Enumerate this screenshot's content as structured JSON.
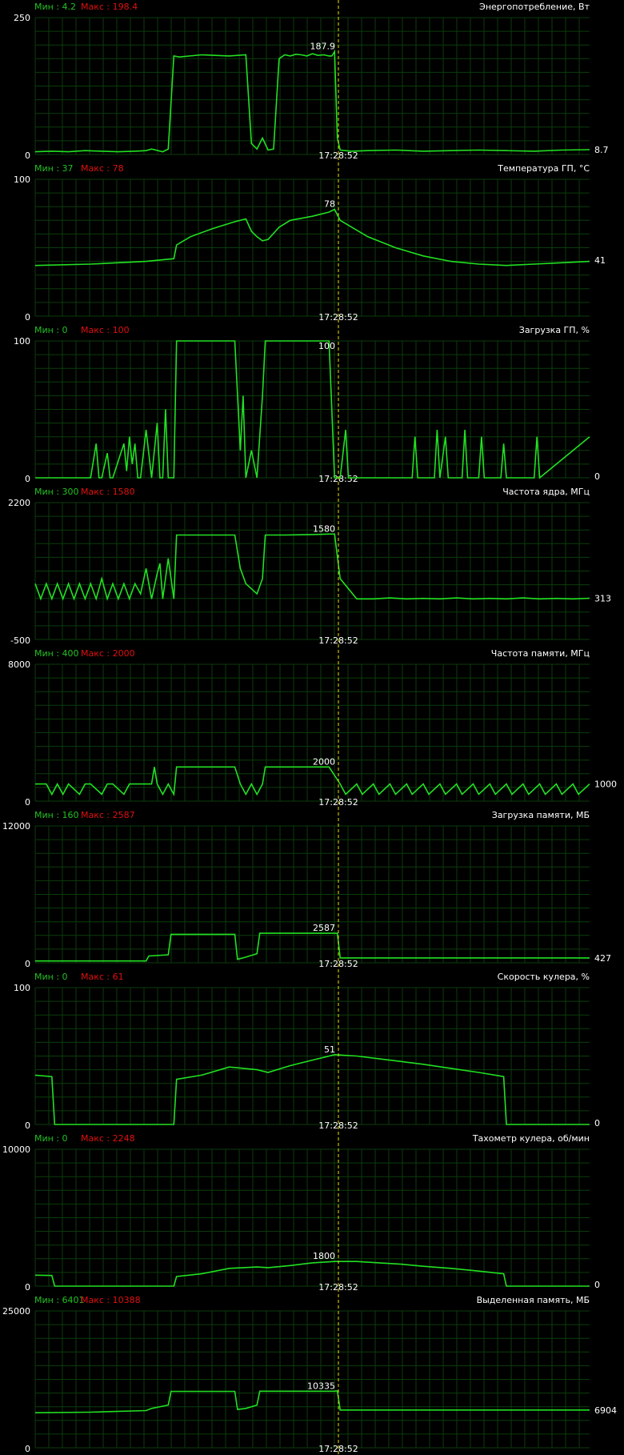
{
  "colors": {
    "background": "#000000",
    "grid": "#0b3d0b",
    "trace": "#22e022",
    "min_label": "#22c022",
    "max_label": "#e01010",
    "cursor": "#f0e000",
    "text": "#ffffff"
  },
  "cursor_time": "17:28:52",
  "chart_data": [
    {
      "type": "line",
      "title": "Энергопотребление, Вт",
      "min_label": "Мин : 4.2",
      "max_label": "Макс : 198.4",
      "ylim": [
        0,
        250
      ],
      "y_top_label": "250",
      "y_bottom_label": "0",
      "cursor_value": "187.9",
      "current_value": "8.7",
      "x": [
        0,
        3,
        6,
        9,
        12,
        15,
        18,
        20,
        21,
        23,
        24,
        25,
        26,
        30,
        35,
        38,
        39,
        40,
        41,
        42,
        43,
        44,
        45,
        46,
        47,
        48,
        49,
        50,
        51,
        52,
        53,
        53.5,
        54,
        54.5,
        55,
        57,
        60,
        65,
        70,
        75,
        80,
        85,
        90,
        95,
        100
      ],
      "y": [
        5,
        6,
        5,
        7,
        6,
        5,
        6,
        7,
        10,
        5,
        10,
        180,
        178,
        182,
        180,
        182,
        20,
        10,
        30,
        8,
        10,
        175,
        182,
        180,
        183,
        182,
        180,
        184,
        181,
        182,
        180,
        180,
        187.9,
        30,
        8,
        6,
        7,
        8,
        6,
        7,
        8,
        7,
        6,
        8,
        8.7
      ]
    },
    {
      "type": "line",
      "title": "Температура ГП, °C",
      "min_label": "Мин : 37",
      "max_label": "Макс : 78",
      "ylim": [
        0,
        100
      ],
      "y_top_label": "100",
      "y_bottom_label": "0",
      "cursor_value": "78",
      "current_value": "41",
      "x": [
        0,
        10,
        20,
        25,
        25.5,
        28,
        32,
        36,
        38,
        39,
        40,
        41,
        42,
        44,
        46,
        50,
        53,
        54,
        55,
        60,
        65,
        70,
        75,
        80,
        85,
        90,
        95,
        100
      ],
      "y": [
        37,
        38,
        40,
        42,
        52,
        58,
        64,
        69,
        71,
        62,
        58,
        55,
        56,
        65,
        70,
        73,
        76,
        78,
        70,
        58,
        50,
        44,
        40,
        38,
        37,
        38,
        39,
        40
      ]
    },
    {
      "type": "line",
      "title": "Загрузка ГП, %",
      "min_label": "Мин : 0",
      "max_label": "Макс : 100",
      "ylim": [
        0,
        100
      ],
      "y_top_label": "100",
      "y_bottom_label": "0",
      "cursor_value": "100",
      "current_value": "0",
      "x": [
        0,
        10,
        11,
        11.5,
        12,
        13,
        13.5,
        14,
        16,
        16.5,
        17,
        17.5,
        18,
        18.5,
        19,
        20,
        21,
        22,
        22.5,
        23,
        23.5,
        24,
        24.5,
        25,
        25.5,
        27,
        32,
        36,
        37,
        37.5,
        38,
        39,
        40,
        41,
        41.5,
        42,
        48,
        53,
        54,
        55,
        56,
        56.5,
        57,
        58,
        68,
        68.5,
        69,
        72,
        72.5,
        73,
        74,
        74.5,
        75,
        77,
        77.5,
        78,
        80,
        80.5,
        81,
        84,
        84.5,
        85,
        90,
        90.5,
        91,
        100
      ],
      "y": [
        0,
        0,
        25,
        0,
        0,
        18,
        0,
        0,
        25,
        5,
        30,
        10,
        25,
        0,
        0,
        35,
        0,
        40,
        0,
        0,
        50,
        0,
        0,
        0,
        100,
        100,
        100,
        100,
        20,
        60,
        0,
        20,
        0,
        60,
        100,
        100,
        100,
        100,
        0,
        0,
        35,
        0,
        0,
        0,
        0,
        30,
        0,
        0,
        35,
        0,
        30,
        0,
        0,
        0,
        35,
        0,
        0,
        30,
        0,
        0,
        25,
        0,
        0,
        30,
        0,
        30
      ]
    },
    {
      "type": "line",
      "title": "Частота ядра, МГц",
      "min_label": "Мин : 300",
      "max_label": "Макс : 1580",
      "ylim": [
        -500,
        2200
      ],
      "y_top_label": "2200",
      "y_bottom_label": "-500",
      "cursor_value": "1580",
      "current_value": "313",
      "x": [
        0,
        1,
        2,
        3,
        4,
        5,
        6,
        7,
        8,
        9,
        10,
        11,
        12,
        13,
        14,
        15,
        16,
        17,
        18,
        19,
        20,
        21,
        22,
        22.5,
        23,
        24,
        25,
        25.5,
        30,
        36,
        37,
        38,
        39,
        40,
        41,
        41.5,
        45,
        50,
        53,
        54,
        55,
        58,
        61,
        64,
        67,
        70,
        73,
        76,
        79,
        82,
        85,
        88,
        91,
        94,
        97,
        100
      ],
      "y": [
        600,
        300,
        600,
        300,
        600,
        300,
        600,
        300,
        600,
        300,
        600,
        300,
        700,
        300,
        600,
        300,
        600,
        300,
        600,
        400,
        900,
        300,
        800,
        1000,
        300,
        1100,
        300,
        1560,
        1560,
        1560,
        900,
        600,
        500,
        400,
        700,
        1560,
        1560,
        1570,
        1580,
        1580,
        700,
        300,
        300,
        320,
        300,
        310,
        300,
        320,
        300,
        310,
        300,
        320,
        300,
        310,
        300,
        313
      ]
    },
    {
      "type": "line",
      "title": "Частота памяти, МГц",
      "min_label": "Мин : 400",
      "max_label": "Макс : 2000",
      "ylim": [
        0,
        8000
      ],
      "y_top_label": "8000",
      "y_bottom_label": "0",
      "cursor_value": "2000",
      "current_value": "1000",
      "x": [
        0,
        2,
        3,
        4,
        5,
        6,
        8,
        9,
        10,
        12,
        13,
        14,
        16,
        17,
        18,
        21,
        21.5,
        22,
        23,
        24,
        25,
        25.5,
        36,
        37,
        38,
        39,
        40,
        41,
        41.5,
        53,
        55,
        56,
        58,
        59,
        61,
        62,
        64,
        65,
        67,
        68,
        70,
        71,
        73,
        74,
        76,
        77,
        79,
        80,
        82,
        83,
        85,
        86,
        88,
        89,
        91,
        92,
        94,
        95,
        97,
        98,
        100
      ],
      "y": [
        1000,
        1000,
        400,
        1000,
        400,
        1000,
        400,
        1000,
        1000,
        400,
        1000,
        1000,
        400,
        1000,
        1000,
        1000,
        2000,
        1000,
        400,
        1000,
        400,
        2000,
        2000,
        1000,
        400,
        1000,
        400,
        1000,
        2000,
        2000,
        1000,
        400,
        1000,
        400,
        1000,
        400,
        1000,
        400,
        1000,
        400,
        1000,
        400,
        1000,
        400,
        1000,
        400,
        1000,
        400,
        1000,
        400,
        1000,
        400,
        1000,
        400,
        1000,
        400,
        1000,
        400,
        1000,
        400,
        1000
      ]
    },
    {
      "type": "line",
      "title": "Загрузка памяти, МБ",
      "min_label": "Мин : 160",
      "max_label": "Макс : 2587",
      "ylim": [
        0,
        12000
      ],
      "y_top_label": "12000",
      "y_bottom_label": "0",
      "cursor_value": "2587",
      "current_value": "427",
      "x": [
        0,
        10,
        20,
        20.5,
        24,
        24.5,
        36,
        36.5,
        38,
        40,
        40.5,
        53,
        54,
        54.5,
        55,
        60,
        70,
        80,
        90,
        100
      ],
      "y": [
        160,
        160,
        160,
        600,
        700,
        2500,
        2500,
        300,
        500,
        800,
        2587,
        2587,
        2587,
        2587,
        427,
        427,
        427,
        427,
        427,
        427
      ]
    },
    {
      "type": "line",
      "title": "Скорость кулера, %",
      "min_label": "Мин : 0",
      "max_label": "Макс : 61",
      "ylim": [
        0,
        100
      ],
      "y_top_label": "100",
      "y_bottom_label": "0",
      "cursor_value": "51",
      "current_value": "0",
      "x": [
        0,
        3,
        3.5,
        25,
        25.5,
        30,
        35,
        40,
        42,
        46,
        50,
        54,
        58,
        62,
        66,
        70,
        75,
        80,
        84.5,
        85,
        100
      ],
      "y": [
        36,
        35,
        0,
        0,
        33,
        36,
        42,
        40,
        38,
        43,
        47,
        51,
        50,
        48,
        46,
        44,
        41,
        38,
        35,
        0,
        0
      ]
    },
    {
      "type": "line",
      "title": "Тахометр кулера, об/мин",
      "min_label": "Мин : 0",
      "max_label": "Макс : 2248",
      "ylim": [
        0,
        10000
      ],
      "y_top_label": "10000",
      "y_bottom_label": "0",
      "cursor_value": "1800",
      "current_value": "0",
      "x": [
        0,
        3,
        3.5,
        25,
        25.5,
        30,
        35,
        40,
        42,
        46,
        50,
        54,
        58,
        62,
        66,
        70,
        75,
        80,
        84.5,
        85,
        100
      ],
      "y": [
        800,
        780,
        0,
        0,
        700,
        900,
        1300,
        1400,
        1350,
        1500,
        1700,
        1800,
        1800,
        1700,
        1600,
        1450,
        1300,
        1100,
        900,
        0,
        0
      ]
    },
    {
      "type": "line",
      "title": "Выделенная память, МБ",
      "min_label": "Мин : 6401",
      "max_label": "Макс : 10388",
      "ylim": [
        0,
        25000
      ],
      "y_top_label": "25000",
      "y_bottom_label": "0",
      "cursor_value": "10335",
      "current_value": "6904",
      "x": [
        0,
        10,
        20,
        21,
        24,
        24.5,
        36,
        36.5,
        38,
        40,
        40.5,
        53,
        54,
        54.5,
        55,
        60,
        70,
        80,
        90,
        100
      ],
      "y": [
        6401,
        6500,
        6800,
        7200,
        7800,
        10300,
        10300,
        7000,
        7200,
        7800,
        10335,
        10335,
        10335,
        10388,
        6904,
        6904,
        6904,
        6904,
        6904,
        6904
      ]
    }
  ]
}
